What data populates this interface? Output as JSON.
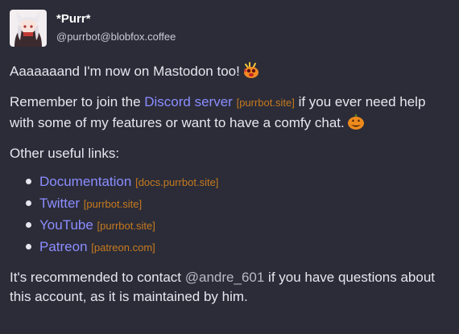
{
  "account": {
    "display_name": "*Purr*",
    "handle": "@purrbot@blobfox.coffee"
  },
  "post": {
    "line1": "Aaaaaaand I'm now on Mastodon too!",
    "p2_pre": "Remember to join the ",
    "discord_link": "Discord server",
    "discord_domain": "[purrbot.site]",
    "p2_post": " if you ever need help with some of my features or want to have a comfy chat.",
    "links_heading": "Other useful links:",
    "links": [
      {
        "label": "Documentation",
        "domain": "[docs.purrbot.site]"
      },
      {
        "label": "Twitter",
        "domain": "[purrbot.site]"
      },
      {
        "label": "YouTube",
        "domain": "[purrbot.site]"
      },
      {
        "label": "Patreon",
        "domain": "[patreon.com]"
      }
    ],
    "p4_pre": "It's recommended to contact ",
    "mention": "@andre_601",
    "p4_post": " if you have questions about this account, as it is maintained by him."
  },
  "colors": {
    "background": "#2b2c38",
    "link": "#8c8dff",
    "domain": "#c77a1e"
  },
  "icons": [
    "avatar",
    "blob-party-emoji",
    "blob-pumpkin-emoji"
  ]
}
